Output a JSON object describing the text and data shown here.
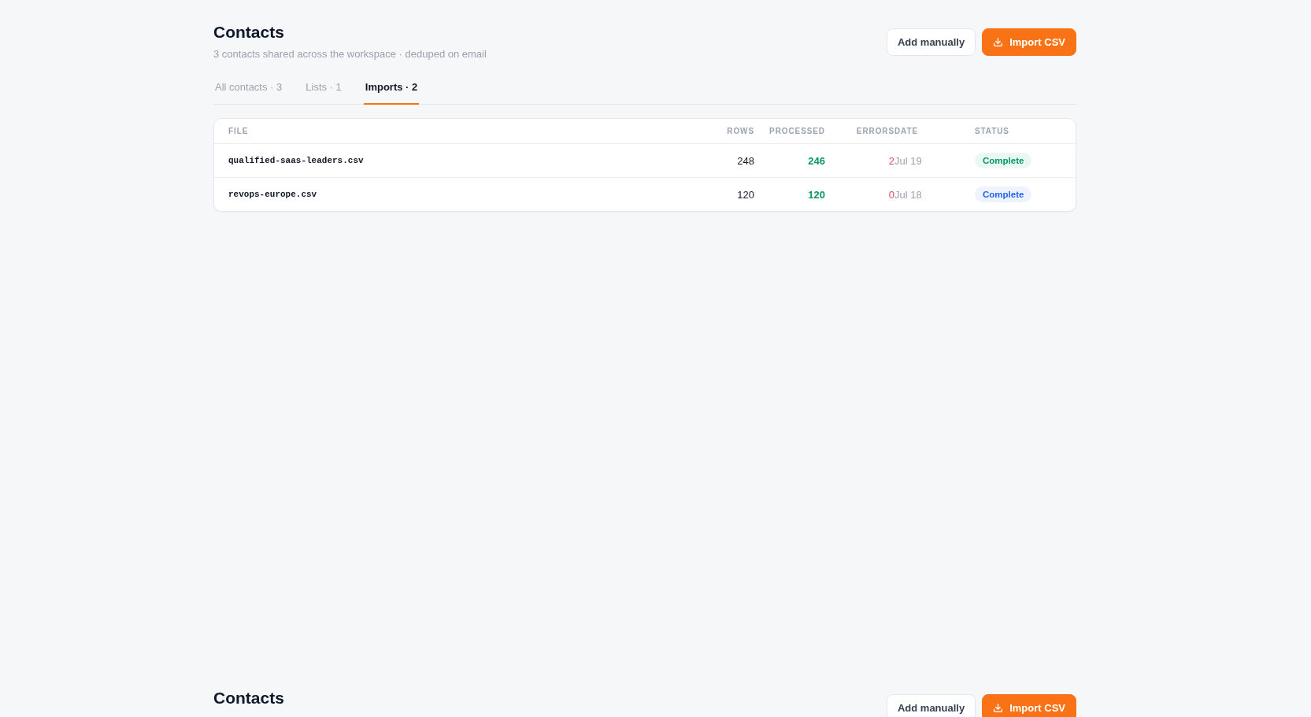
{
  "sections": [
    {
      "title": "Contacts",
      "subtitle": "3 contacts shared across the workspace · deduped on email",
      "actions": [
        {
          "kind": "secondary",
          "label": "Add manually"
        },
        {
          "kind": "primary",
          "label": "Import CSV"
        }
      ],
      "tabs": [
        {
          "label": "All contacts · 3",
          "selected": false
        },
        {
          "label": "Lists · 1",
          "selected": false
        },
        {
          "label": "Imports · 2",
          "selected": true
        }
      ],
      "table": {
        "columns": [
          "FILE",
          "ROWS",
          "PROCESSED",
          "ERRORS",
          "DATE",
          "STATUS"
        ],
        "rows": [
          {
            "file": "qualified-saas-leaders.csv",
            "rows": "248",
            "processed": "246",
            "errors": "2",
            "date": "Jul 19",
            "status": {
              "label": "Complete",
              "color": "#059669"
            }
          },
          {
            "file": "revops-europe.csv",
            "rows": "120",
            "processed": "120",
            "errors": "0",
            "date": "Jul 18",
            "status": {
              "label": "Complete",
              "color": "#2563eb"
            }
          }
        ]
      }
    },
    {
      "title": "Contacts",
      "actions": [
        {
          "kind": "secondary",
          "label": "Add manually"
        },
        {
          "kind": "primary",
          "label": "Import CSV"
        }
      ]
    }
  ]
}
